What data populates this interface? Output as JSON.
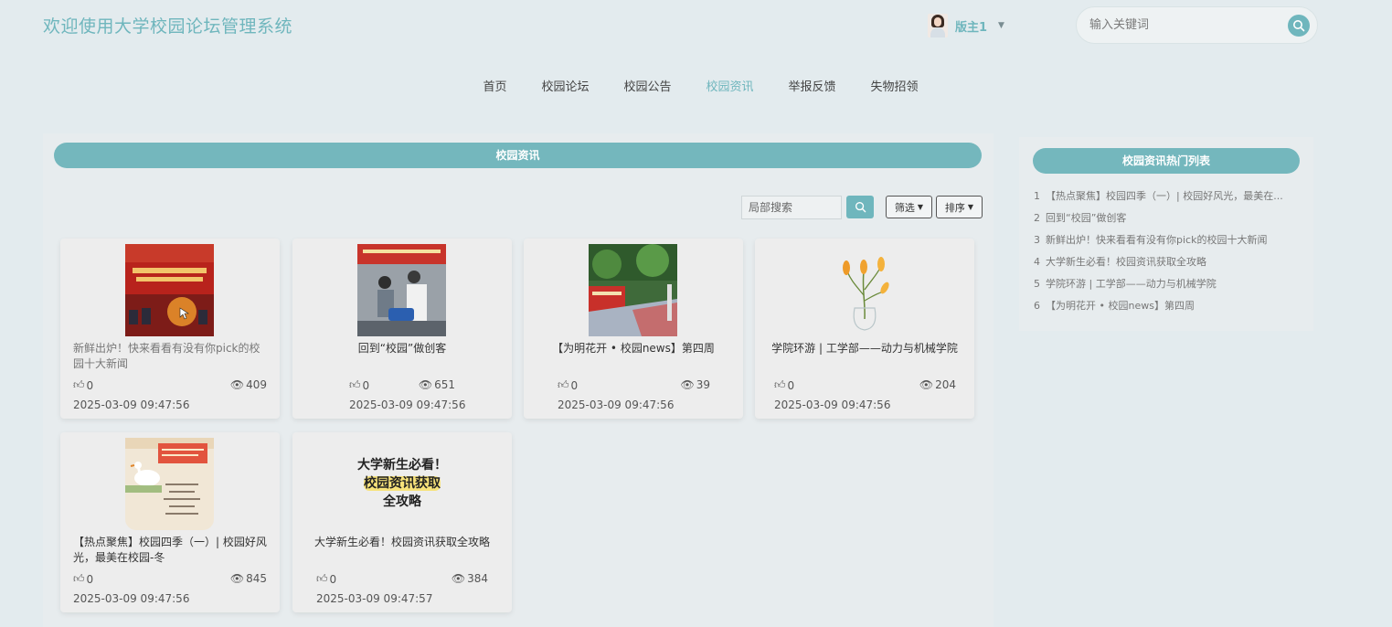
{
  "header": {
    "site_title": "欢迎使用大学校园论坛管理系统",
    "user_name": "版主1",
    "search_placeholder": "输入关键词"
  },
  "nav": {
    "items": [
      "首页",
      "校园论坛",
      "校园公告",
      "校园资讯",
      "举报反馈",
      "失物招领"
    ],
    "active_index": 3
  },
  "main": {
    "section_title": "校园资讯",
    "local_search_placeholder": "局部搜索",
    "filter_label": "筛选",
    "sort_label": "排序",
    "cards": [
      {
        "title": "新鲜出炉！快来看看有没有你pick的校园十大新闻",
        "likes": "0",
        "views": "409",
        "date": "2025-03-09 09:47:56"
      },
      {
        "title": "回到“校园”做创客",
        "likes": "0",
        "views": "651",
        "date": "2025-03-09 09:47:56"
      },
      {
        "title": "【为明花开 • 校园news】第四周",
        "likes": "0",
        "views": "39",
        "date": "2025-03-09 09:47:56"
      },
      {
        "title": "学院环游 | 工学部——动力与机械学院",
        "likes": "0",
        "views": "204",
        "date": "2025-03-09 09:47:56"
      },
      {
        "title": "【热点聚焦】校园四季（一）| 校园好风光，最美在校园-冬",
        "likes": "0",
        "views": "845",
        "date": "2025-03-09 09:47:56"
      },
      {
        "title": "大学新生必看！校园资讯获取全攻略",
        "likes": "0",
        "views": "384",
        "date": "2025-03-09 09:47:57"
      }
    ],
    "thumb_text": {
      "card5_line": "大学新生必看！",
      "card6_line1": "大学新生必看！",
      "card6_line2": "校园资讯获取",
      "card6_line3": "全攻略"
    }
  },
  "side": {
    "title": "校园资讯热门列表",
    "items": [
      {
        "num": "1",
        "text": "【热点聚焦】校园四季（一）| 校园好风光，最美在..."
      },
      {
        "num": "2",
        "text": "回到“校园”做创客"
      },
      {
        "num": "3",
        "text": "新鲜出炉！快来看看有没有你pick的校园十大新闻"
      },
      {
        "num": "4",
        "text": "大学新生必看！校园资讯获取全攻略"
      },
      {
        "num": "5",
        "text": "学院环游 | 工学部——动力与机械学院"
      },
      {
        "num": "6",
        "text": "【为明花开 • 校园news】第四周"
      }
    ]
  },
  "colors": {
    "accent": "#6fb6bd",
    "header_bar": "#74b7bd",
    "background": "#e3ebee"
  }
}
